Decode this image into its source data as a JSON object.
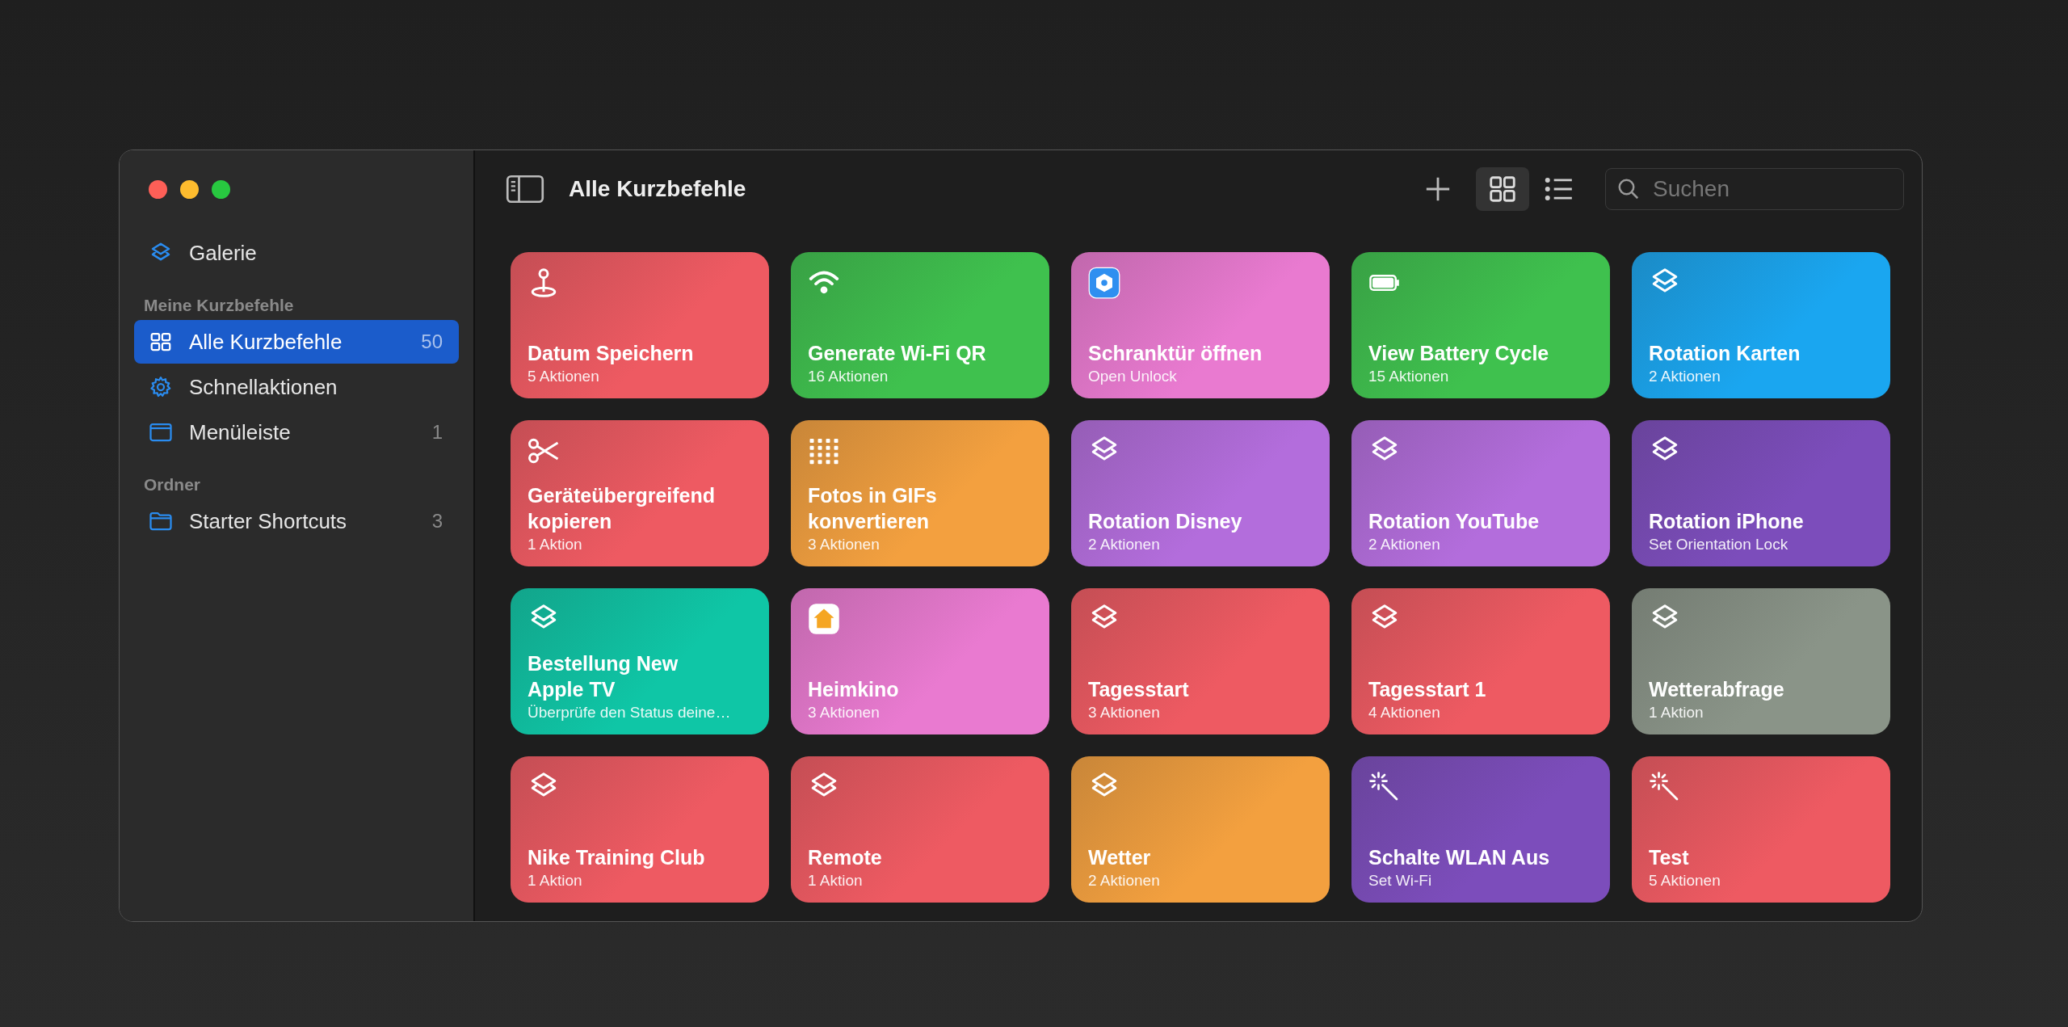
{
  "sidebar": {
    "top_item": {
      "label": "Galerie",
      "kind": "layers",
      "selected": false
    },
    "sections": [
      {
        "title": "Meine Kurzbefehle",
        "items": [
          {
            "label": "Alle Kurzbefehle",
            "kind": "grid",
            "count": "50",
            "selected": true
          },
          {
            "label": "Schnellaktionen",
            "kind": "gear",
            "selected": false
          },
          {
            "label": "Menüleiste",
            "kind": "window",
            "count": "1",
            "selected": false
          }
        ]
      },
      {
        "title": "Ordner",
        "items": [
          {
            "label": "Starter Shortcuts",
            "kind": "folder",
            "count": "3",
            "selected": false
          }
        ]
      }
    ]
  },
  "toolbar": {
    "title": "Alle Kurzbefehle",
    "view_modes": [
      {
        "kind": "grid",
        "selected": true
      },
      {
        "kind": "list",
        "selected": false
      }
    ],
    "search": {
      "placeholder": "Suchen"
    }
  },
  "shortcuts": [
    {
      "title": "Datum Speichern",
      "subtitle": "5 Aktionen",
      "kind": "pin",
      "color": "#ee5a62"
    },
    {
      "title": "Generate Wi-Fi QR",
      "subtitle": "16 Aktionen",
      "kind": "wifi",
      "color": "#3fc14e"
    },
    {
      "title": "Schranktür öffnen",
      "subtitle": "Open Unlock",
      "kind": "app-blue",
      "color": "#e97ad0"
    },
    {
      "title": "View Battery Cycle",
      "subtitle": "15 Aktionen",
      "kind": "battery",
      "color": "#3fc14e"
    },
    {
      "title": "Rotation Karten",
      "subtitle": "2 Aktionen",
      "kind": "layers",
      "color": "#1aa6f0"
    },
    {
      "title": "Geräteübergreifend kopieren",
      "subtitle": "1 Aktion",
      "kind": "scissors",
      "color": "#ee5a62"
    },
    {
      "title": "Fotos in GIFs konvertieren",
      "subtitle": "3 Aktionen",
      "kind": "dots",
      "color": "#f3a03f"
    },
    {
      "title": "Rotation Disney",
      "subtitle": "2 Aktionen",
      "kind": "layers",
      "color": "#b36ddc"
    },
    {
      "title": "Rotation YouTube",
      "subtitle": "2 Aktionen",
      "kind": "layers",
      "color": "#b36ddc"
    },
    {
      "title": "Rotation iPhone",
      "subtitle": "Set Orientation Lock",
      "kind": "layers",
      "color": "#7c4dbb"
    },
    {
      "title": "Bestellung New Apple TV",
      "subtitle": "Überprüfe den Status deine…",
      "kind": "layers",
      "color": "#0fc6a6"
    },
    {
      "title": "Heimkino",
      "subtitle": "3 Aktionen",
      "kind": "app-home",
      "color": "#e97ad0"
    },
    {
      "title": "Tagesstart",
      "subtitle": "3 Aktionen",
      "kind": "layers",
      "color": "#ee5a62"
    },
    {
      "title": "Tagesstart 1",
      "subtitle": "4 Aktionen",
      "kind": "layers",
      "color": "#ee5a62"
    },
    {
      "title": "Wetterabfrage",
      "subtitle": "1 Aktion",
      "kind": "layers",
      "color": "#8a9488"
    },
    {
      "title": "Nike Training Club",
      "subtitle": "1 Aktion",
      "kind": "layers",
      "color": "#ee5a62"
    },
    {
      "title": "Remote",
      "subtitle": "1 Aktion",
      "kind": "layers",
      "color": "#ee5a62"
    },
    {
      "title": "Wetter",
      "subtitle": "2 Aktionen",
      "kind": "layers",
      "color": "#f3a03f"
    },
    {
      "title": "Schalte WLAN Aus",
      "subtitle": "Set Wi-Fi",
      "kind": "wand",
      "color": "#7c4dbb"
    },
    {
      "title": "Test",
      "subtitle": "5 Aktionen",
      "kind": "wand",
      "color": "#ee5a62"
    }
  ]
}
